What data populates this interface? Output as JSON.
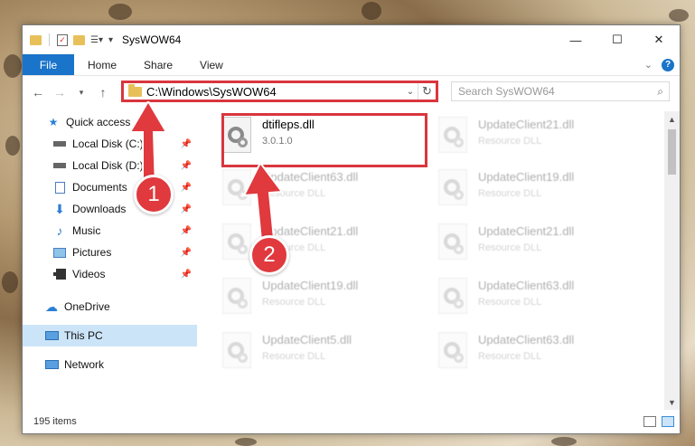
{
  "window": {
    "title": "SysWOW64",
    "controls": {
      "minimize": "—",
      "maximize": "☐",
      "close": "✕"
    }
  },
  "ribbon": {
    "file_tab": "File",
    "tabs": [
      "Home",
      "Share",
      "View"
    ],
    "help": "?"
  },
  "nav": {
    "address": "C:\\Windows\\SysWOW64",
    "search_placeholder": "Search SysWOW64"
  },
  "sidebar": {
    "items": [
      {
        "label": "Quick access",
        "icon": "star-icon"
      },
      {
        "label": "Local Disk (C:)",
        "icon": "drive-icon"
      },
      {
        "label": "Local Disk (D:)",
        "icon": "drive-icon"
      },
      {
        "label": "Documents",
        "icon": "documents-icon"
      },
      {
        "label": "Downloads",
        "icon": "download-icon"
      },
      {
        "label": "Music",
        "icon": "music-icon"
      },
      {
        "label": "Pictures",
        "icon": "pictures-icon"
      },
      {
        "label": "Videos",
        "icon": "videos-icon"
      },
      {
        "label": "OneDrive",
        "icon": "cloud-icon"
      },
      {
        "label": "This PC",
        "icon": "computer-icon"
      },
      {
        "label": "Network",
        "icon": "network-icon"
      }
    ]
  },
  "files": [
    {
      "name": "dtifleps.dll",
      "meta": "3.0.1.0"
    },
    {
      "name": "UpdateClient21.dll",
      "meta": "Resource DLL"
    },
    {
      "name": "UpdateClient63.dll",
      "meta": "Resource DLL"
    },
    {
      "name": "UpdateClient19.dll",
      "meta": "Resource DLL"
    },
    {
      "name": "UpdateClient21.dll",
      "meta": "Resource DLL"
    },
    {
      "name": "UpdateClient21.dll",
      "meta": "Resource DLL"
    },
    {
      "name": "UpdateClient19.dll",
      "meta": "Resource DLL"
    },
    {
      "name": "UpdateClient63.dll",
      "meta": "Resource DLL"
    },
    {
      "name": "UpdateClient5.dll",
      "meta": "Resource DLL"
    },
    {
      "name": "UpdateClient63.dll",
      "meta": "Resource DLL"
    }
  ],
  "status": {
    "count": "195 items"
  },
  "annotations": {
    "step1": "1",
    "step2": "2"
  },
  "colors": {
    "accent": "#1a74c9",
    "highlight": "#d9363e",
    "selection": "#cce4f7"
  }
}
